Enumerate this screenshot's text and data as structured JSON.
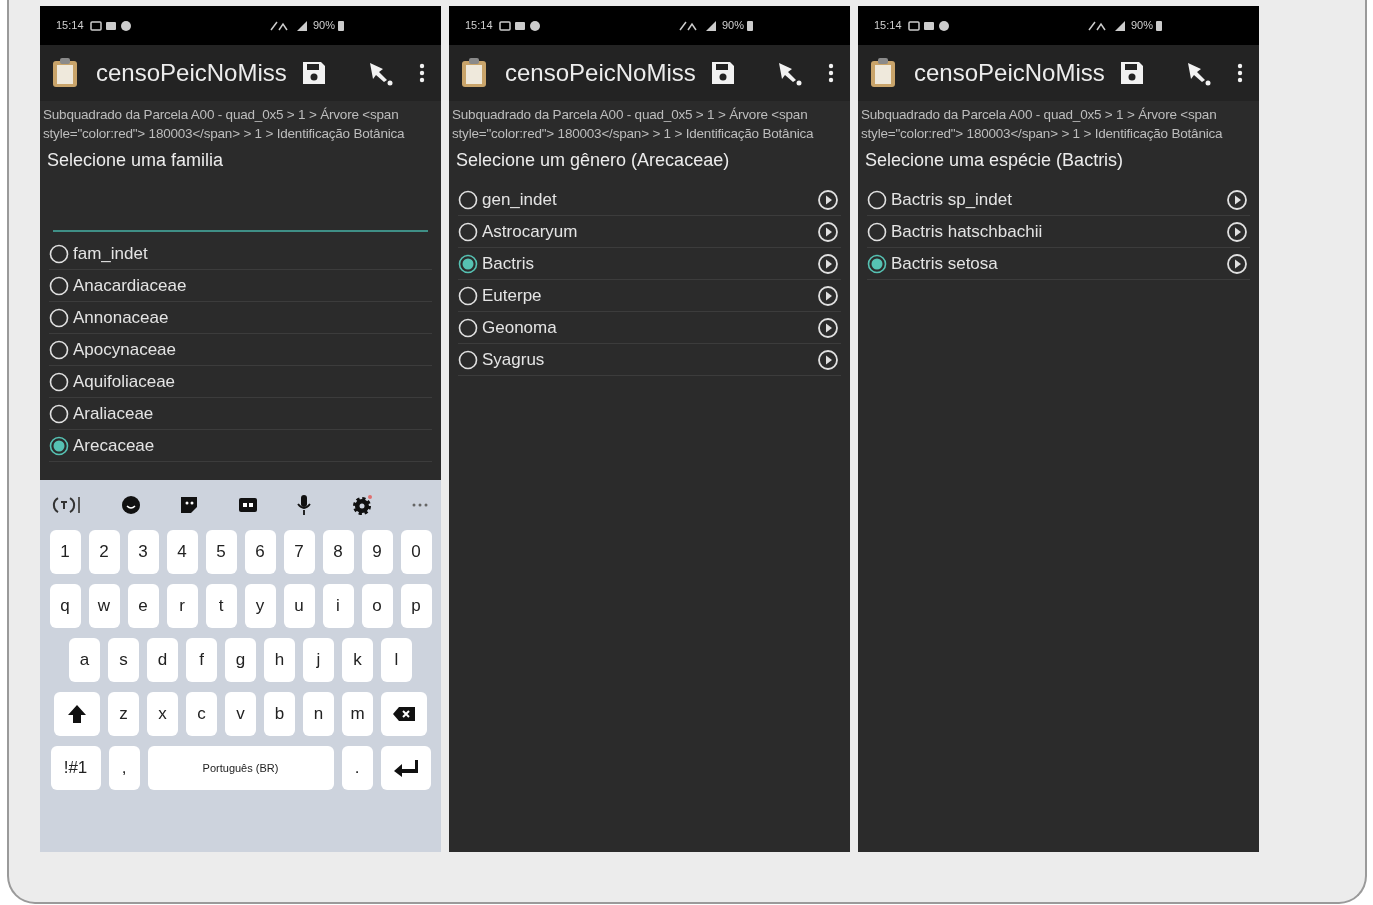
{
  "screens": [
    {
      "status_bar": {
        "time": "15:14",
        "battery": "90%"
      },
      "app_bar": {
        "title": "censoPeicNoMiss"
      },
      "breadcrumb": "Subquadrado da Parcela A00 - quad_0x5 > 1 > Árvore <span style=\"color:red\"> 180003</span> > 1 > Identificação Botânica",
      "prompt": "Selecione uma familia",
      "filter_field": {
        "focused": true
      },
      "detail_buttons": false,
      "options": [
        {
          "label": "fam_indet",
          "selected": false
        },
        {
          "label": "Anacardiaceae",
          "selected": false
        },
        {
          "label": "Annonaceae",
          "selected": false
        },
        {
          "label": "Apocynaceae",
          "selected": false
        },
        {
          "label": "Aquifoliaceae",
          "selected": false
        },
        {
          "label": "Araliaceae",
          "selected": false
        },
        {
          "label": "Arecaceae",
          "selected": true
        }
      ],
      "keyboard": {
        "key_rows": [
          {
            "keys": [
              {
                "label": "1"
              },
              {
                "label": "2"
              },
              {
                "label": "3"
              },
              {
                "label": "4"
              },
              {
                "label": "5"
              },
              {
                "label": "6"
              },
              {
                "label": "7"
              },
              {
                "label": "8"
              },
              {
                "label": "9"
              },
              {
                "label": "0"
              }
            ]
          },
          {
            "keys": [
              {
                "label": "q"
              },
              {
                "label": "w"
              },
              {
                "label": "e"
              },
              {
                "label": "r"
              },
              {
                "label": "t"
              },
              {
                "label": "y"
              },
              {
                "label": "u"
              },
              {
                "label": "i"
              },
              {
                "label": "o"
              },
              {
                "label": "p"
              }
            ]
          },
          {
            "keys": [
              {
                "label": "a"
              },
              {
                "label": "s"
              },
              {
                "label": "d"
              },
              {
                "label": "f"
              },
              {
                "label": "g"
              },
              {
                "label": "h"
              },
              {
                "label": "j"
              },
              {
                "label": "k"
              },
              {
                "label": "l"
              }
            ]
          },
          {
            "keys": [
              {
                "kind": "shift"
              },
              {
                "label": "z"
              },
              {
                "label": "x"
              },
              {
                "label": "c"
              },
              {
                "label": "v"
              },
              {
                "label": "b"
              },
              {
                "label": "n"
              },
              {
                "label": "m"
              },
              {
                "kind": "backspace"
              }
            ]
          },
          {
            "keys": [
              {
                "label": "!#1",
                "kind": "wide"
              },
              {
                "label": ","
              },
              {
                "label": "Português (BR)",
                "kind": "space"
              },
              {
                "label": "."
              },
              {
                "kind": "enter"
              }
            ]
          }
        ]
      }
    },
    {
      "status_bar": {
        "time": "15:14",
        "battery": "90%"
      },
      "app_bar": {
        "title": "censoPeicNoMiss"
      },
      "breadcrumb": "Subquadrado da Parcela A00 - quad_0x5 > 1 > Árvore <span style=\"color:red\"> 180003</span> > 1 > Identificação Botânica",
      "prompt": "Selecione um gênero (Arecaceae)",
      "detail_buttons": true,
      "options": [
        {
          "label": "gen_indet",
          "selected": false
        },
        {
          "label": "Astrocaryum",
          "selected": false
        },
        {
          "label": "Bactris",
          "selected": true
        },
        {
          "label": "Euterpe",
          "selected": false
        },
        {
          "label": "Geonoma",
          "selected": false
        },
        {
          "label": "Syagrus",
          "selected": false
        }
      ]
    },
    {
      "status_bar": {
        "time": "15:14",
        "battery": "90%"
      },
      "app_bar": {
        "title": "censoPeicNoMiss"
      },
      "breadcrumb": "Subquadrado da Parcela A00 - quad_0x5 > 1 > Árvore <span style=\"color:red\"> 180003</span> > 1 > Identificação Botânica",
      "prompt": "Selecione uma espécie (Bactris)",
      "detail_buttons": true,
      "options": [
        {
          "label": "Bactris sp_indet",
          "selected": false
        },
        {
          "label": "Bactris hatschbachii",
          "selected": false
        },
        {
          "label": "Bactris setosa",
          "selected": true
        }
      ]
    }
  ]
}
